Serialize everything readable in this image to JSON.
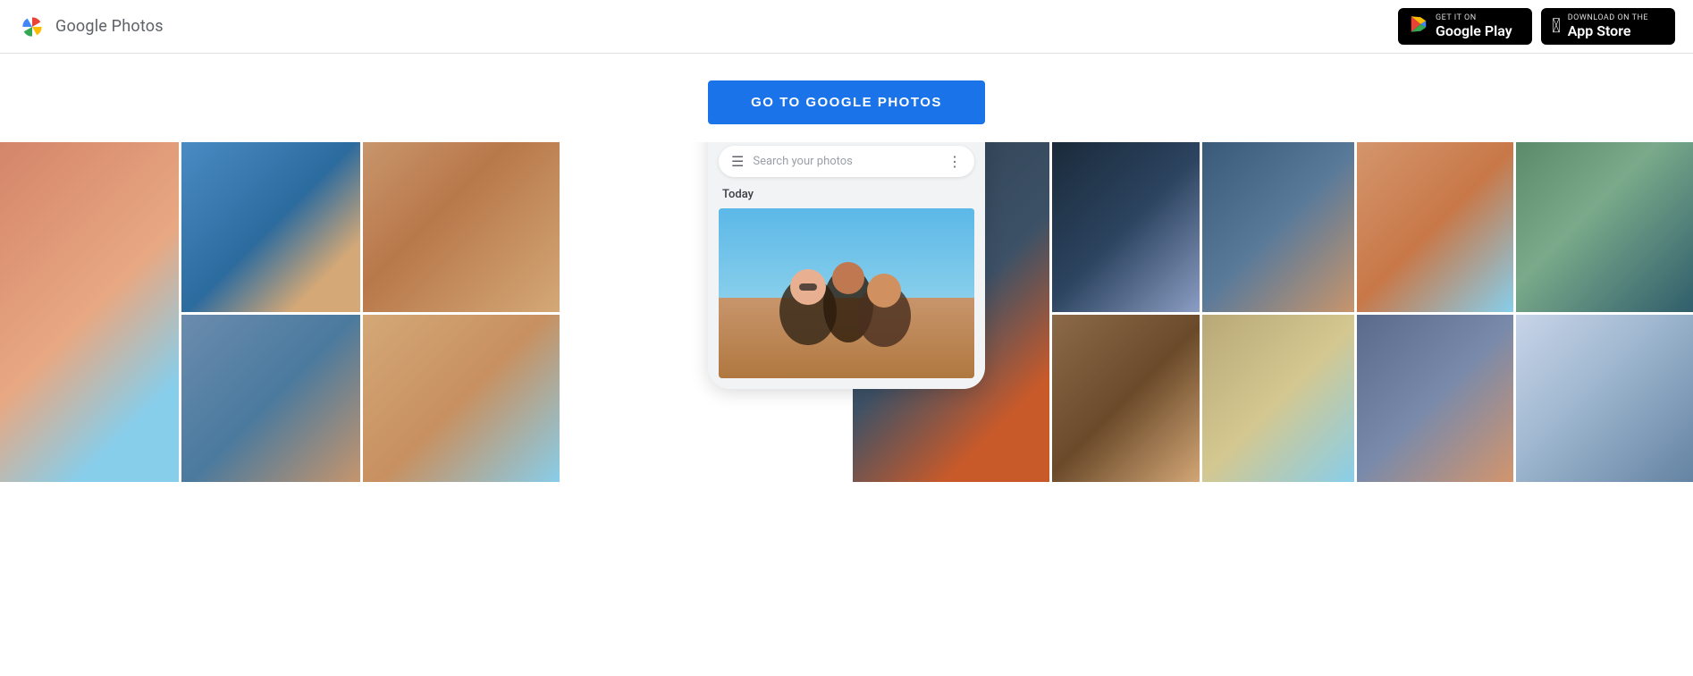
{
  "header": {
    "logo_text": "Google Photos",
    "google_play_badge": {
      "top_text": "GET IT ON",
      "bottom_text": "Google Play",
      "icon": "▶"
    },
    "app_store_badge": {
      "top_text": "Download on the",
      "bottom_text": "App Store",
      "icon": ""
    }
  },
  "cta": {
    "button_label": "GO TO GOOGLE PHOTOS"
  },
  "phone": {
    "search_placeholder": "Search your photos",
    "date_label": "Today"
  }
}
